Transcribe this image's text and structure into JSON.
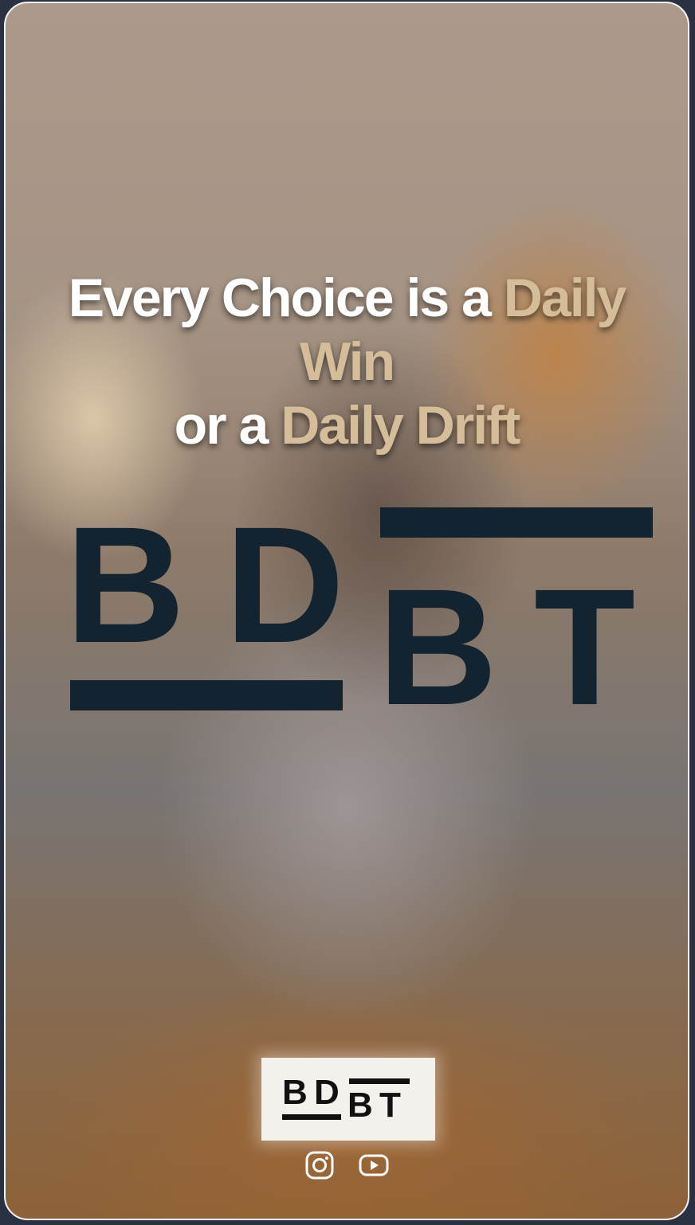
{
  "headline": {
    "line1_a": "Every Choice is a ",
    "line1_b": "Daily",
    "line2": "Win",
    "line3_a": "or a ",
    "line3_b": "Daily Drift"
  },
  "logo": {
    "letters": [
      "B",
      "D",
      "B",
      "T"
    ],
    "color": "#13232f"
  },
  "colors": {
    "highlight": "#d4bd98",
    "text": "#ffffff",
    "logo_bg": "#f4f0ec"
  },
  "socials": [
    {
      "icon": "instagram-icon"
    },
    {
      "icon": "youtube-icon"
    }
  ]
}
